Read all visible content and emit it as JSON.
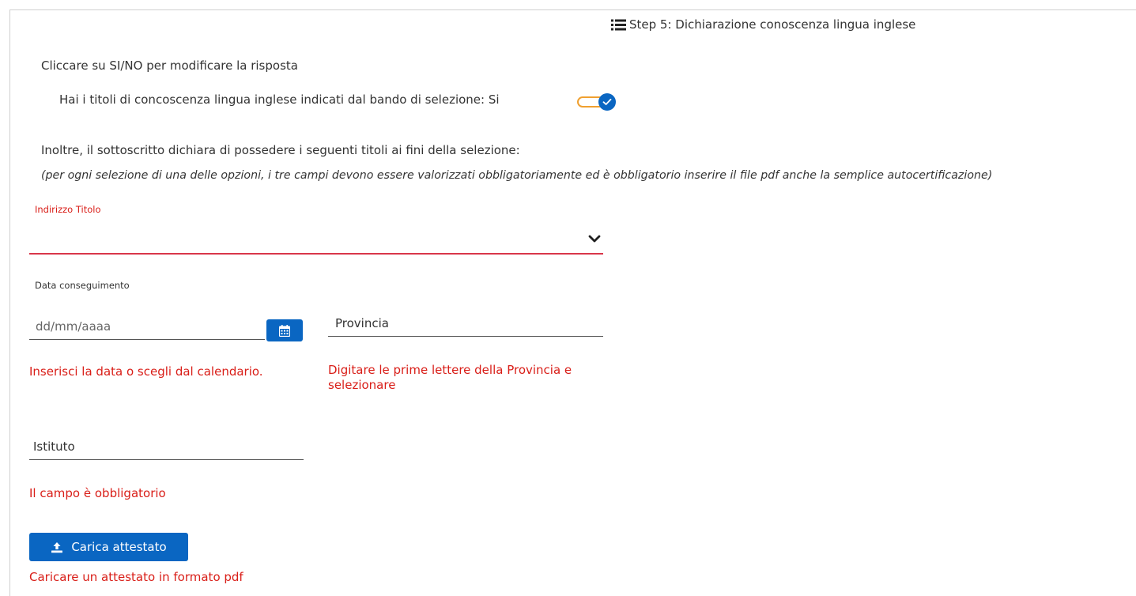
{
  "step": {
    "icon": "list-icon",
    "title": "Step 5: Dichiarazione conoscenza lingua inglese"
  },
  "instruction": "Cliccare su SI/NO per modificare la risposta",
  "question": {
    "text": "Hai i titoli di concoscenza lingua inglese indicati dal bando di selezione: Si",
    "toggle_on": true
  },
  "declaration": "Inoltre, il sottoscritto dichiara di possedere i seguenti titoli ai fini della selezione:",
  "note": "(per ogni selezione di una delle opzioni, i tre campi devono essere valorizzati obbligatoriamente ed è obbligatorio inserire il file pdf anche la semplice autocertificazione)",
  "indirizzo": {
    "label": "Indirizzo Titolo",
    "value": ""
  },
  "data_conseguimento": {
    "label": "Data conseguimento",
    "placeholder": "dd/mm/aaaa",
    "error": "Inserisci la data o scegli dal calendario."
  },
  "provincia": {
    "placeholder": "Provincia",
    "error_line1": "Digitare le prime lettere della Provincia e",
    "error_line2": "selezionare"
  },
  "istituto": {
    "placeholder": "Istituto",
    "error": "Il campo è obbligatorio"
  },
  "upload": {
    "label": "Carica attestato",
    "hint": "Caricare un attestato in formato pdf"
  },
  "colors": {
    "primary": "#0a66c2",
    "error": "#d91e18",
    "toggle_track": "#f0a030"
  }
}
